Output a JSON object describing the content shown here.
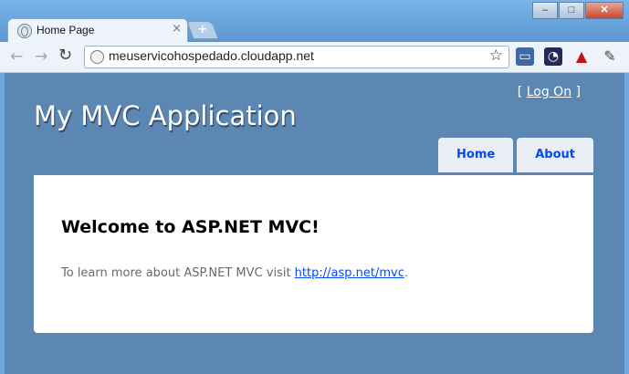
{
  "browser": {
    "tab_title": "Home Page",
    "tab_close": "×",
    "new_tab": "+",
    "window_buttons": {
      "minimize": "–",
      "maximize": "□",
      "close": "✕"
    },
    "address": "meuservicohospedado.cloudapp.net"
  },
  "page": {
    "login": {
      "open_bracket": "[",
      "link": "Log On",
      "close_bracket": "]"
    },
    "title": "My MVC Application",
    "menu": [
      {
        "label": "Home"
      },
      {
        "label": "About"
      }
    ],
    "content": {
      "heading": "Welcome to ASP.NET MVC!",
      "text": "To learn more about ASP.NET MVC visit ",
      "link": "http://asp.net/mvc",
      "suffix": "."
    }
  }
}
